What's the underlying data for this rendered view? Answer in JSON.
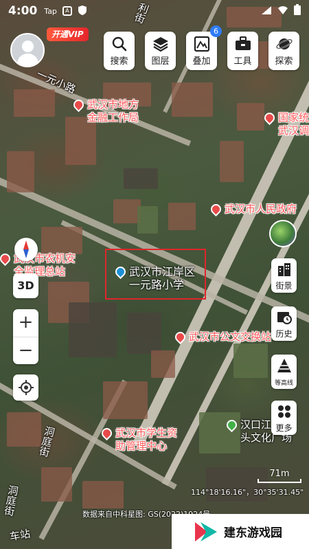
{
  "status_bar": {
    "time": "4:00",
    "indicators": [
      "Tap",
      "A",
      "shield-icon"
    ],
    "right_icons": [
      "signal-icon",
      "wifi-icon",
      "battery-icon"
    ]
  },
  "user": {
    "vip_label": "开通VIP"
  },
  "toolbar": {
    "search": "搜索",
    "layers": "图层",
    "overlay": "叠加",
    "overlay_badge": "6",
    "tools": "工具",
    "explore": "探索"
  },
  "map": {
    "streets": {
      "street_top": "利街",
      "street_yiyuan": "一元小路",
      "street_dongting": "洞庭街",
      "street_bottom": "洞庭街",
      "street_corner": "车站"
    },
    "pois": {
      "finance_bureau": "武汉市地方\n金融工作局",
      "statistics_bureau": "国家统\n武汉调",
      "government": "武汉市人民政府",
      "agri_safety": "武汉市农机安\n全监理总站",
      "school": "武汉市江岸区\n一元路小学",
      "exchange_station": "武汉市公文交换站",
      "student_aid": "武汉市学生资\n助管理中心",
      "cultural_plaza": "汉口江滩码\n头文化广场"
    }
  },
  "controls": {
    "three_d": "3D",
    "zoom_in": "+",
    "zoom_out": "−"
  },
  "side_buttons": {
    "street_view": "街景",
    "history": "历史",
    "contour": "等高线",
    "more": "更多"
  },
  "scale": "71m",
  "coordinates": "114°18'16.16\"，30°35'31.45\"",
  "attribution": "数据来自中科星图: GS(2022)1924号",
  "watermark": "建东游戏园"
}
